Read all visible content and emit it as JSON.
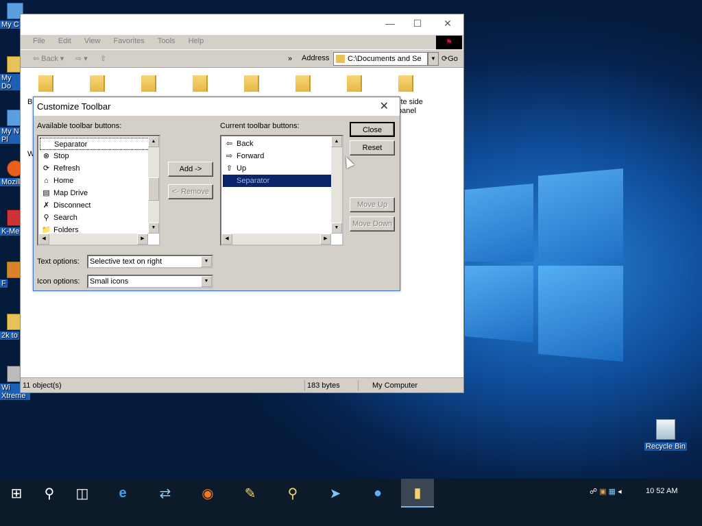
{
  "desktop": {
    "icons": [
      {
        "label": "My C",
        "icon": "computer-icon"
      },
      {
        "label": "My Do",
        "icon": "documents-icon"
      },
      {
        "label": "My N Pl",
        "icon": "network-icon"
      },
      {
        "label": "Mozill",
        "icon": "firefox-icon"
      },
      {
        "label": "K-Me",
        "icon": "media-icon"
      },
      {
        "label": "F",
        "icon": "app-icon"
      },
      {
        "label": "2k to",
        "icon": "folder-icon"
      },
      {
        "label": "Wi Xtreme",
        "icon": "app-icon"
      }
    ],
    "recycle_bin_label": "Recycle Bin"
  },
  "explorer": {
    "menu": [
      "File",
      "Edit",
      "View",
      "Favorites",
      "Tools",
      "Help"
    ],
    "toolbar": {
      "back_label": "Back",
      "address_label": "Address",
      "address_value": "C:\\Documents and Se",
      "go_label": "Go"
    },
    "folder_labels": [
      "B",
      "W",
      "ite side",
      "panel"
    ],
    "status": {
      "objects": "11 object(s)",
      "size": "183 bytes",
      "location": "My Computer"
    }
  },
  "dialog": {
    "title": "Customize Toolbar",
    "available_label": "Available toolbar buttons:",
    "current_label": "Current toolbar buttons:",
    "available_items": [
      {
        "label": "Separator",
        "icon": "separator-icon"
      },
      {
        "label": "Stop",
        "icon": "stop-icon"
      },
      {
        "label": "Refresh",
        "icon": "refresh-icon"
      },
      {
        "label": "Home",
        "icon": "home-icon"
      },
      {
        "label": "Map Drive",
        "icon": "map-drive-icon"
      },
      {
        "label": "Disconnect",
        "icon": "disconnect-icon"
      },
      {
        "label": "Search",
        "icon": "search-icon"
      },
      {
        "label": "Folders",
        "icon": "folders-icon"
      }
    ],
    "current_items": [
      {
        "label": "Back",
        "icon": "back-arrow-icon"
      },
      {
        "label": "Forward",
        "icon": "forward-arrow-icon"
      },
      {
        "label": "Up",
        "icon": "up-folder-icon"
      },
      {
        "label": "Separator",
        "icon": "separator-icon"
      }
    ],
    "buttons": {
      "add": "Add ->",
      "remove": "<- Remove",
      "close": "Close",
      "reset": "Reset",
      "move_up": "Move Up",
      "move_down": "Move Down"
    },
    "text_options_label": "Text options:",
    "text_options_value": "Selective text on right",
    "icon_options_label": "Icon options:",
    "icon_options_value": "Small icons"
  },
  "taskbar": {
    "clock": "10 52 AM",
    "apps": [
      "start-icon",
      "search-icon",
      "task-view-icon",
      "internet-explorer-icon",
      "sync-icon",
      "firefox-icon",
      "notepad-icon",
      "magnifier-icon",
      "mail-icon",
      "globe-icon",
      "file-explorer-icon"
    ]
  }
}
